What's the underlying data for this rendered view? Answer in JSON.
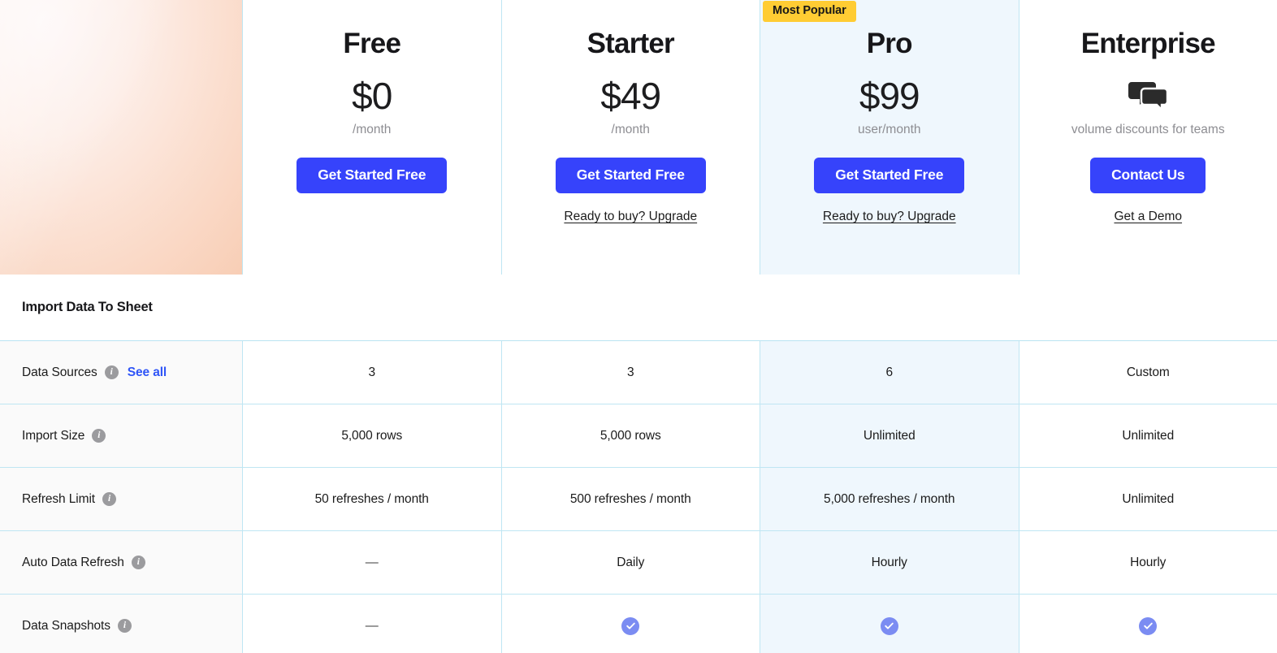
{
  "colors": {
    "cta_blue": "#3643fb",
    "badge_yellow": "#ffcc33",
    "featured_tint": "#eff7fd",
    "grid_line": "#bfe6f3",
    "link_blue": "#2f55f7",
    "check_badge": "#7b8cf2",
    "info_icon_gray": "#9b9b9e"
  },
  "plans": [
    {
      "name": "Free",
      "price": "$0",
      "period": "/month",
      "cta_label": "Get Started Free",
      "sub_link": null,
      "badge": null,
      "icon": null,
      "featured": false
    },
    {
      "name": "Starter",
      "price": "$49",
      "period": "/month",
      "cta_label": "Get Started Free",
      "sub_link": "Ready to buy? Upgrade",
      "badge": null,
      "icon": null,
      "featured": false
    },
    {
      "name": "Pro",
      "price": "$99",
      "period": "user/month",
      "cta_label": "Get Started Free",
      "sub_link": "Ready to buy? Upgrade",
      "badge": "Most Popular",
      "icon": null,
      "featured": true
    },
    {
      "name": "Enterprise",
      "price": null,
      "period": "volume discounts for teams",
      "cta_label": "Contact Us",
      "sub_link": "Get a Demo",
      "badge": null,
      "icon": "chat-bubbles-icon",
      "featured": false
    }
  ],
  "section": {
    "title": "Import Data To Sheet"
  },
  "features": [
    {
      "label": "Data Sources",
      "info": "i",
      "link": "See all",
      "values": [
        "3",
        "3",
        "6",
        "Custom"
      ],
      "types": [
        "text",
        "text",
        "text",
        "text"
      ]
    },
    {
      "label": "Import Size",
      "info": "i",
      "link": null,
      "values": [
        "5,000 rows",
        "5,000 rows",
        "Unlimited",
        "Unlimited"
      ],
      "types": [
        "text",
        "text",
        "text",
        "text"
      ]
    },
    {
      "label": "Refresh Limit",
      "info": "i",
      "link": null,
      "values": [
        "50 refreshes / month",
        "500 refreshes / month",
        "5,000 refreshes / month",
        "Unlimited"
      ],
      "types": [
        "text",
        "text",
        "text",
        "text"
      ]
    },
    {
      "label": "Auto Data Refresh",
      "info": "i",
      "link": null,
      "values": [
        "—",
        "Daily",
        "Hourly",
        "Hourly"
      ],
      "types": [
        "dash",
        "text",
        "text",
        "text"
      ]
    },
    {
      "label": "Data Snapshots",
      "info": "i",
      "link": null,
      "values": [
        "—",
        "",
        "",
        ""
      ],
      "types": [
        "dash",
        "check",
        "check",
        "check"
      ]
    }
  ]
}
